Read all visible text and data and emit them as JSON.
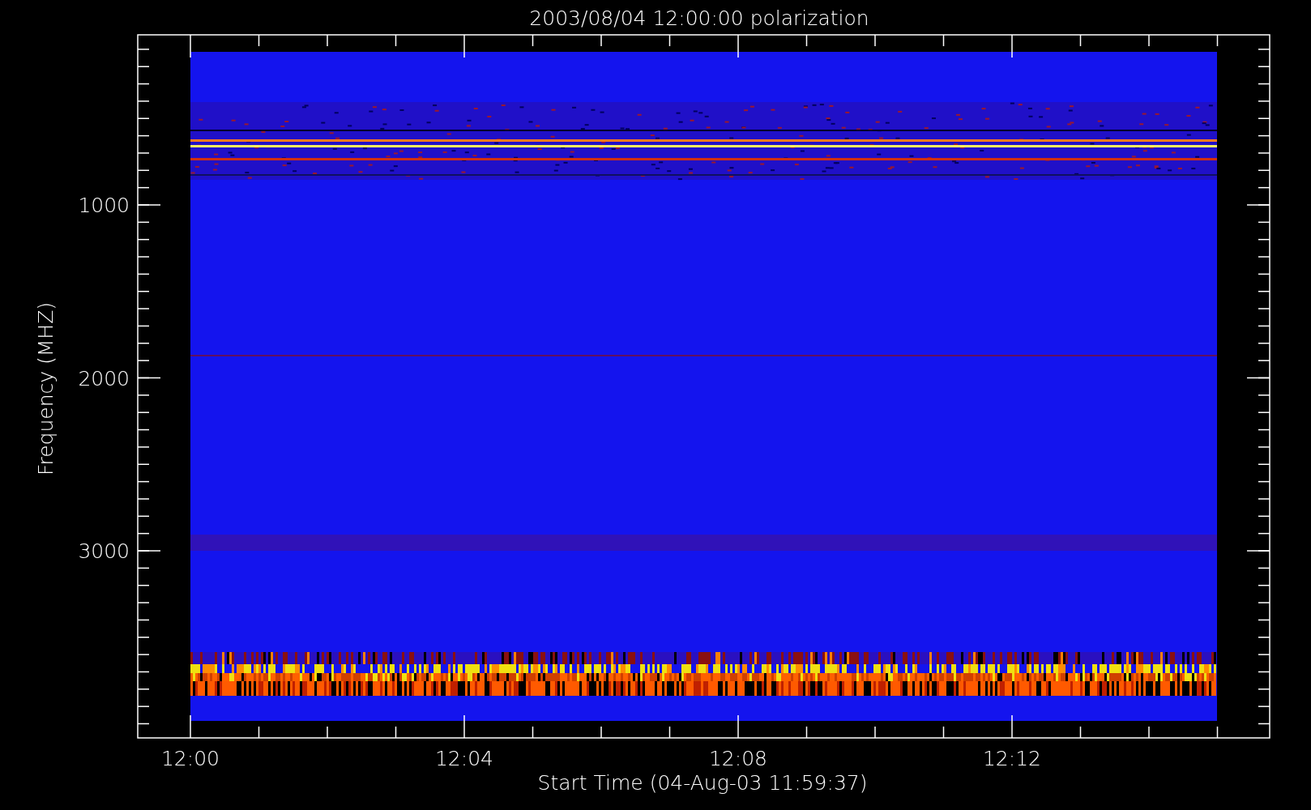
{
  "title": "2003/08/04 12:00:00 polarization",
  "xlabel": "Start Time (04-Aug-03 11:59:37)",
  "ylabel": "Frequency (MHZ)",
  "xticks": [
    "12:00",
    "12:04",
    "12:08",
    "12:12"
  ],
  "yticks": [
    "1000",
    "2000",
    "3000"
  ]
}
